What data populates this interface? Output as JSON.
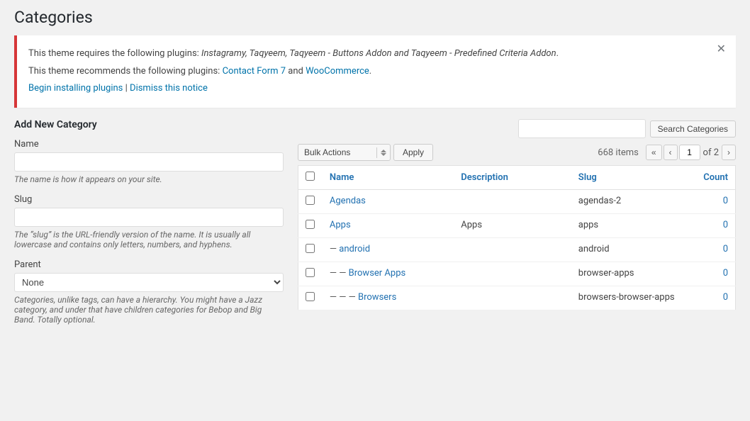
{
  "page": {
    "title": "Categories"
  },
  "notice": {
    "required_text": "This theme requires the following plugins: ",
    "required_plugins": "Instagramy, Taqyeem, Taqyeem - Buttons Addon",
    "and_text": " and ",
    "predefined": "Taqyeem - Predefined Criteria Addon",
    "end_dot": ".",
    "recommends_text": "This theme recommends the following plugins: ",
    "contact_form": "Contact Form 7",
    "woocommerce": "WooCommerce",
    "begin_link": "Begin installing plugins",
    "separator": " | ",
    "dismiss_link": "Dismiss this notice"
  },
  "add_form": {
    "heading": "Add New Category",
    "name_label": "Name",
    "name_placeholder": "",
    "name_hint": "The name is how it appears on your site.",
    "slug_label": "Slug",
    "slug_placeholder": "",
    "slug_hint": "The “slug” is the URL-friendly version of the name. It is usually all lowercase and contains only letters, numbers, and hyphens.",
    "parent_label": "Parent",
    "parent_options": [
      "None"
    ],
    "parent_hint": "Categories, unlike tags, can have a hierarchy. You might have a Jazz category, and under that have children categories for Bebop and Big Band. Totally optional."
  },
  "toolbar": {
    "search_placeholder": "",
    "search_button": "Search Categories",
    "bulk_actions_label": "Bulk Actions",
    "apply_label": "Apply",
    "items_count": "668 items",
    "page_current": "1",
    "page_of": "of 2"
  },
  "table": {
    "headers": {
      "name": "Name",
      "description": "Description",
      "slug": "Slug",
      "count": "Count"
    },
    "rows": [
      {
        "id": 1,
        "name": "Agendas",
        "indent": 0,
        "prefix": "",
        "description": "",
        "slug": "agendas-2",
        "count": "0"
      },
      {
        "id": 2,
        "name": "Apps",
        "indent": 0,
        "prefix": "",
        "description": "Apps",
        "slug": "apps",
        "count": "0"
      },
      {
        "id": 3,
        "name": "android",
        "indent": 1,
        "prefix": "— ",
        "description": "",
        "slug": "android",
        "count": "0"
      },
      {
        "id": 4,
        "name": "Browser Apps",
        "indent": 2,
        "prefix": "— — ",
        "description": "",
        "slug": "browser-apps",
        "count": "0"
      },
      {
        "id": 5,
        "name": "Browsers",
        "indent": 3,
        "prefix": "— — — ",
        "description": "",
        "slug": "browsers-browser-apps",
        "count": "0"
      }
    ]
  }
}
